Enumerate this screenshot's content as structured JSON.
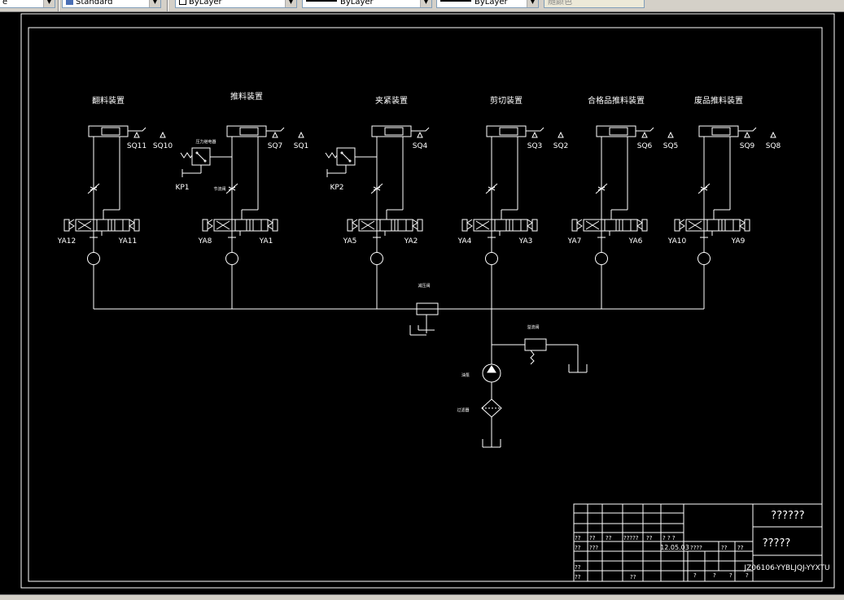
{
  "toolbar": {
    "partial_left": "e",
    "textstyle": "Standard",
    "color": "ByLayer",
    "linetype": "ByLayer",
    "lineweight": "ByLayer",
    "plotstyle": "随颜色"
  },
  "drawing": {
    "stations": [
      {
        "title": "翻料装置",
        "switch_a": "SQ11",
        "switch_b": "SQ10",
        "valve_left": "YA12",
        "valve_right": "YA11"
      },
      {
        "title": "推料装置",
        "switch_a": "SQ7",
        "switch_b": "SQ1",
        "valve_left": "YA8",
        "valve_right": "YA1"
      },
      {
        "title": "夹紧装置",
        "switch_a": "SQ4",
        "switch_b": "",
        "valve_left": "YA5",
        "valve_right": "YA2"
      },
      {
        "title": "剪切装置",
        "switch_a": "SQ3",
        "switch_b": "SQ2",
        "valve_left": "YA4",
        "valve_right": "YA3"
      },
      {
        "title": "合格品推料装置",
        "switch_a": "SQ6",
        "switch_b": "SQ5",
        "valve_left": "YA7",
        "valve_right": "YA6"
      },
      {
        "title": "废品推料装置",
        "switch_a": "SQ9",
        "switch_b": "SQ8",
        "valve_left": "YA10",
        "valve_right": "YA9"
      }
    ],
    "pressure_switch_1": "KP1",
    "pressure_switch_2": "KP2",
    "pressure_switch_label": "压力继电器",
    "small_valve_label": "节流阀",
    "reducing_valve_label": "减压阀",
    "relief_valve_label": "溢流阀",
    "pump_label": "油泵",
    "filter_label": "过滤器"
  },
  "title_block": {
    "drawing_name": "??????",
    "school": "?????",
    "drawing_number": "JZ06106-YYBLJQJ-YYXTU",
    "date": "12.05.03",
    "header_row": [
      "??",
      "??",
      "??",
      "?????",
      "??",
      "? ? ?"
    ],
    "row2_label": "??",
    "row2_value": "???",
    "row3_label": "??",
    "row4_label": "??",
    "row4_value": "??",
    "stage_labels": [
      "????",
      "??",
      "??"
    ],
    "sheet_marks": [
      "?",
      "?",
      "?",
      "?"
    ]
  },
  "colors": {
    "background": "#000000",
    "lines": "#ffffff",
    "toolbar": "#d4d0c8"
  }
}
